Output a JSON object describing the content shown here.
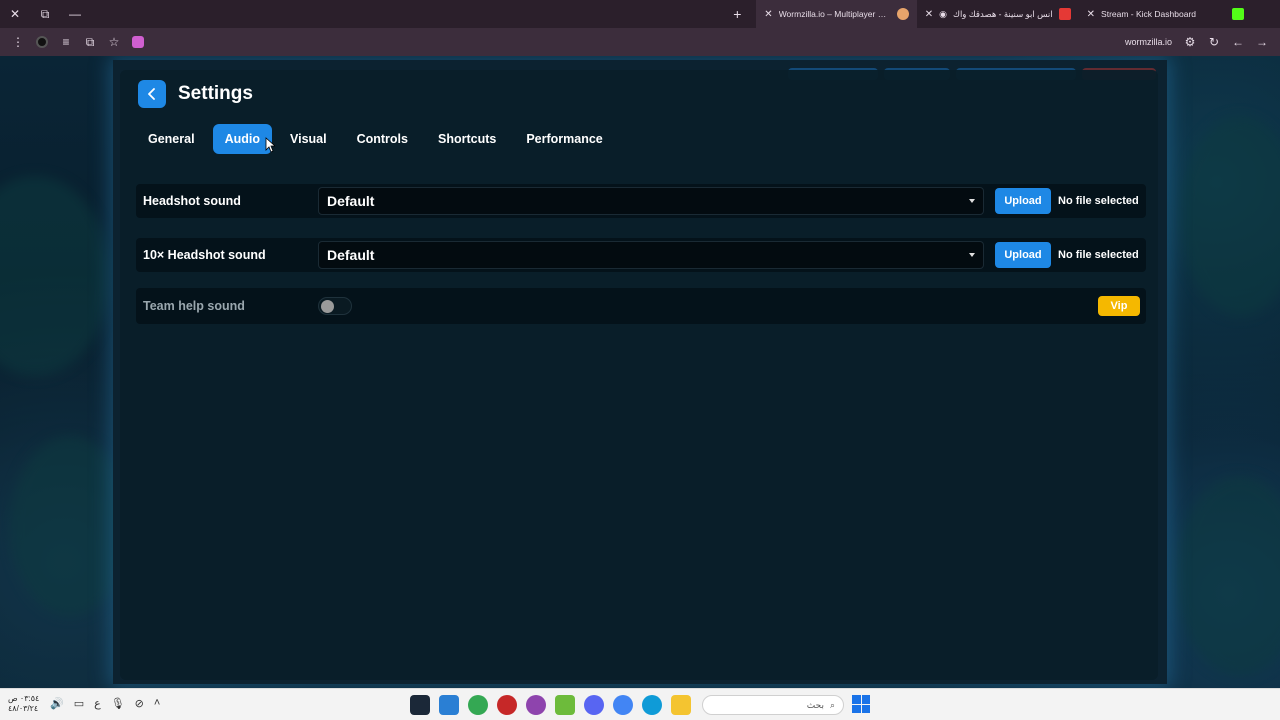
{
  "browser": {
    "tabs": [
      {
        "title": "Wormzilla.io – Multiplayer Snak",
        "active": true
      },
      {
        "title": "انس ابو سنينة - هصدقك واك"
      },
      {
        "title": "Stream - Kick Dashboard"
      }
    ],
    "url": "wormzilla.io"
  },
  "settings": {
    "title": "Settings",
    "tabs": [
      {
        "label": "General",
        "active": false
      },
      {
        "label": "Audio",
        "active": true
      },
      {
        "label": "Visual",
        "active": false
      },
      {
        "label": "Controls",
        "active": false
      },
      {
        "label": "Shortcuts",
        "active": false
      },
      {
        "label": "Performance",
        "active": false
      }
    ],
    "rows": [
      {
        "label": "Headshot sound",
        "select_value": "Default",
        "upload_label": "Upload",
        "file_status": "No file selected"
      },
      {
        "label": "10× Headshot sound",
        "select_value": "Default",
        "upload_label": "Upload",
        "file_status": "No file selected"
      },
      {
        "label": "Team help sound",
        "toggle_on": false,
        "badge": "Vip"
      }
    ]
  },
  "taskbar": {
    "time": "٠٣:٥٤ ص",
    "date": "٤٨/٠٣/٢٤",
    "search_placeholder": "بحث"
  },
  "colors": {
    "accent": "#1e88e5",
    "vip": "#f5b800",
    "panel": "#091e29"
  }
}
